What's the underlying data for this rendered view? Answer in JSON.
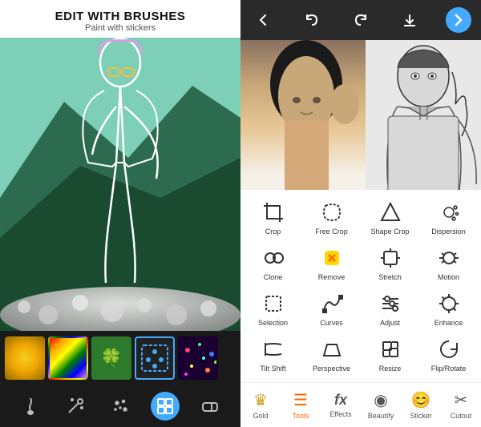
{
  "left": {
    "title": "EDIT WITH BRUSHES",
    "subtitle": "Paint with stickers",
    "stickers": [
      {
        "id": "gold",
        "type": "gold",
        "label": "Gold"
      },
      {
        "id": "rainbow",
        "type": "rainbow",
        "label": "Rainbow"
      },
      {
        "id": "clover",
        "type": "clover",
        "label": "Clover"
      },
      {
        "id": "selected",
        "type": "selected",
        "label": "Selected"
      },
      {
        "id": "confetti",
        "type": "confetti",
        "label": "Confetti"
      }
    ],
    "tools": [
      {
        "id": "brush",
        "icon": "✏️",
        "active": false
      },
      {
        "id": "magic",
        "icon": "🪄",
        "active": false
      },
      {
        "id": "sparkle",
        "icon": "✨",
        "active": false
      },
      {
        "id": "sticker-brush",
        "icon": "🖌️",
        "active": true
      },
      {
        "id": "eraser",
        "icon": "◻",
        "active": false
      }
    ]
  },
  "right": {
    "header": {
      "back_icon": "←",
      "undo_icon": "↩",
      "redo_icon": "↪",
      "download_icon": "⬇",
      "next_icon": "→"
    },
    "tools": [
      [
        {
          "id": "crop",
          "label": "Crop"
        },
        {
          "id": "free-crop",
          "label": "Free Crop"
        },
        {
          "id": "shape-crop",
          "label": "Shape Crop"
        },
        {
          "id": "dispersion",
          "label": "Dispersion"
        }
      ],
      [
        {
          "id": "clone",
          "label": "Clone"
        },
        {
          "id": "remove",
          "label": "Remove"
        },
        {
          "id": "stretch",
          "label": "Stretch"
        },
        {
          "id": "motion",
          "label": "Motion"
        }
      ],
      [
        {
          "id": "selection",
          "label": "Selection"
        },
        {
          "id": "curves",
          "label": "Curves"
        },
        {
          "id": "adjust",
          "label": "Adjust"
        },
        {
          "id": "enhance",
          "label": "Enhance"
        }
      ],
      [
        {
          "id": "tilt-shift",
          "label": "Tilt Shift"
        },
        {
          "id": "perspective",
          "label": "Perspective"
        },
        {
          "id": "resize",
          "label": "Resize"
        },
        {
          "id": "flip-rotate",
          "label": "Flip/Rotate"
        }
      ]
    ],
    "bottom_nav": [
      {
        "id": "gold",
        "label": "Gold",
        "active": false
      },
      {
        "id": "tools",
        "label": "Tools",
        "active": true
      },
      {
        "id": "effects",
        "label": "Effects",
        "active": false
      },
      {
        "id": "beautify",
        "label": "Beautify",
        "active": false
      },
      {
        "id": "sticker",
        "label": "Sticker",
        "active": false
      },
      {
        "id": "cutout",
        "label": "Cutout",
        "active": false
      }
    ]
  }
}
